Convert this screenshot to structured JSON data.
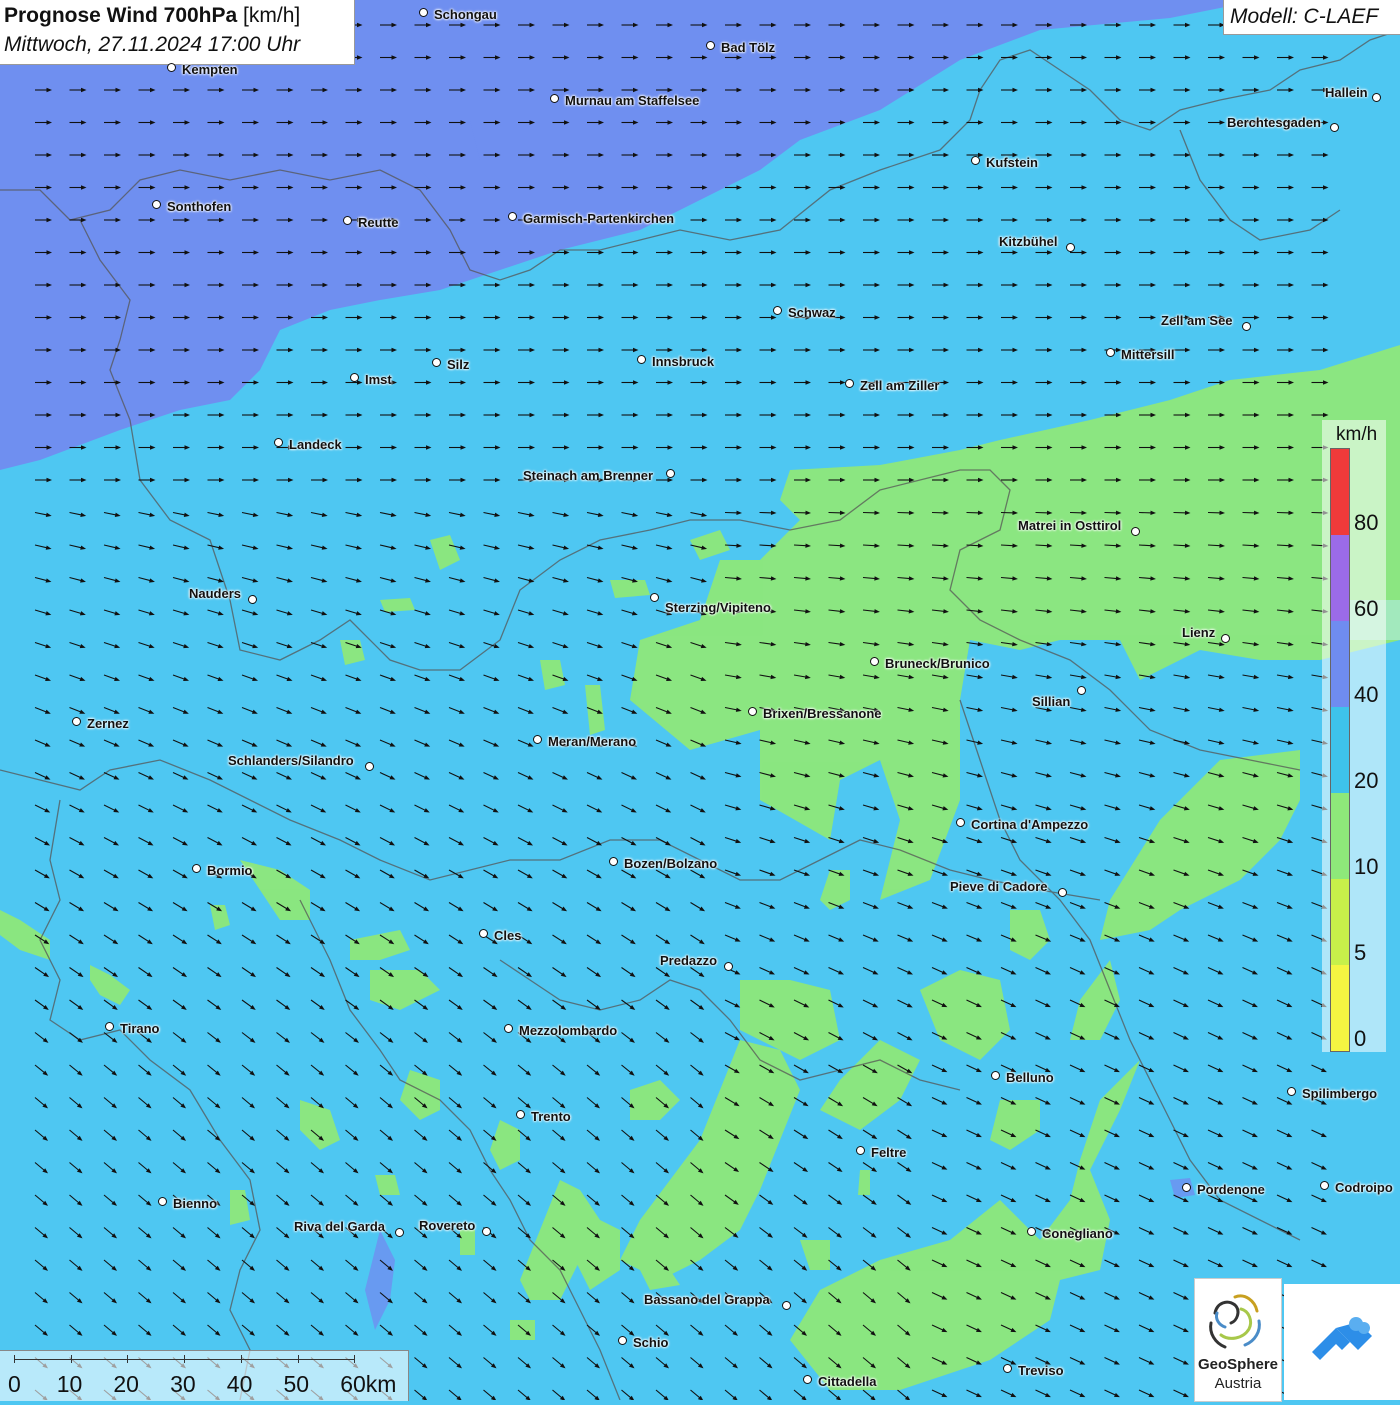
{
  "title": {
    "bold": "Prognose Wind 700hPa",
    "unit": "[km/h]",
    "datetime": "Mittwoch, 27.11.2024 17:00 Uhr"
  },
  "model": "Modell: C-LAEF",
  "legend": {
    "unit": "km/h",
    "ticks": [
      "0",
      "5",
      "10",
      "20",
      "40",
      "60",
      "80"
    ],
    "colors": [
      "#f5f542",
      "#c7f04a",
      "#8ee87a",
      "#3ec3ea",
      "#6f8cf0",
      "#9b6be8",
      "#f03a3a"
    ]
  },
  "scale": {
    "labels": [
      "0",
      "10",
      "20",
      "30",
      "40",
      "50",
      "60km"
    ]
  },
  "logos": {
    "geosphere_name": "GeoSphere",
    "geosphere_sub": "Austria"
  },
  "wind": {
    "direction": "west to east, turning north-west to south-east in the south",
    "speed_range_kmh": [
      5,
      60
    ]
  },
  "cities": [
    {
      "name": "Schongau"
    },
    {
      "name": "Bad Tölz"
    },
    {
      "name": "Kempten"
    },
    {
      "name": "Murnau am Staffelsee"
    },
    {
      "name": "Hallein"
    },
    {
      "name": "Berchtesgaden"
    },
    {
      "name": "Kufstein"
    },
    {
      "name": "Sonthofen"
    },
    {
      "name": "Reutte"
    },
    {
      "name": "Garmisch-Partenkirchen"
    },
    {
      "name": "Kitzbühel"
    },
    {
      "name": "Schwaz"
    },
    {
      "name": "Zell am See"
    },
    {
      "name": "Mittersill"
    },
    {
      "name": "Innsbruck"
    },
    {
      "name": "Silz"
    },
    {
      "name": "Imst"
    },
    {
      "name": "Zell am Ziller"
    },
    {
      "name": "Landeck"
    },
    {
      "name": "Steinach am Brenner"
    },
    {
      "name": "Matrei in Osttirol"
    },
    {
      "name": "Nauders"
    },
    {
      "name": "Sterzing/Vipiteno"
    },
    {
      "name": "Lienz"
    },
    {
      "name": "Bruneck/Brunico"
    },
    {
      "name": "Sillian"
    },
    {
      "name": "Zernez"
    },
    {
      "name": "Brixen/Bressanone"
    },
    {
      "name": "Meran/Merano"
    },
    {
      "name": "Schlanders/Silandro"
    },
    {
      "name": "Cortina d'Ampezzo"
    },
    {
      "name": "Bozen/Bolzano"
    },
    {
      "name": "Bormio"
    },
    {
      "name": "Pieve di Cadore"
    },
    {
      "name": "Cles"
    },
    {
      "name": "Predazzo"
    },
    {
      "name": "Tirano"
    },
    {
      "name": "Mezzolombardo"
    },
    {
      "name": "Belluno"
    },
    {
      "name": "Spilimbergo"
    },
    {
      "name": "Trento"
    },
    {
      "name": "Feltre"
    },
    {
      "name": "Pordenone"
    },
    {
      "name": "Codroipo"
    },
    {
      "name": "Bienno"
    },
    {
      "name": "Riva del Garda"
    },
    {
      "name": "Rovereto"
    },
    {
      "name": "Conegliano"
    },
    {
      "name": "Bassano del Grappa"
    },
    {
      "name": "Schio"
    },
    {
      "name": "Treviso"
    },
    {
      "name": "Cittadella"
    }
  ]
}
